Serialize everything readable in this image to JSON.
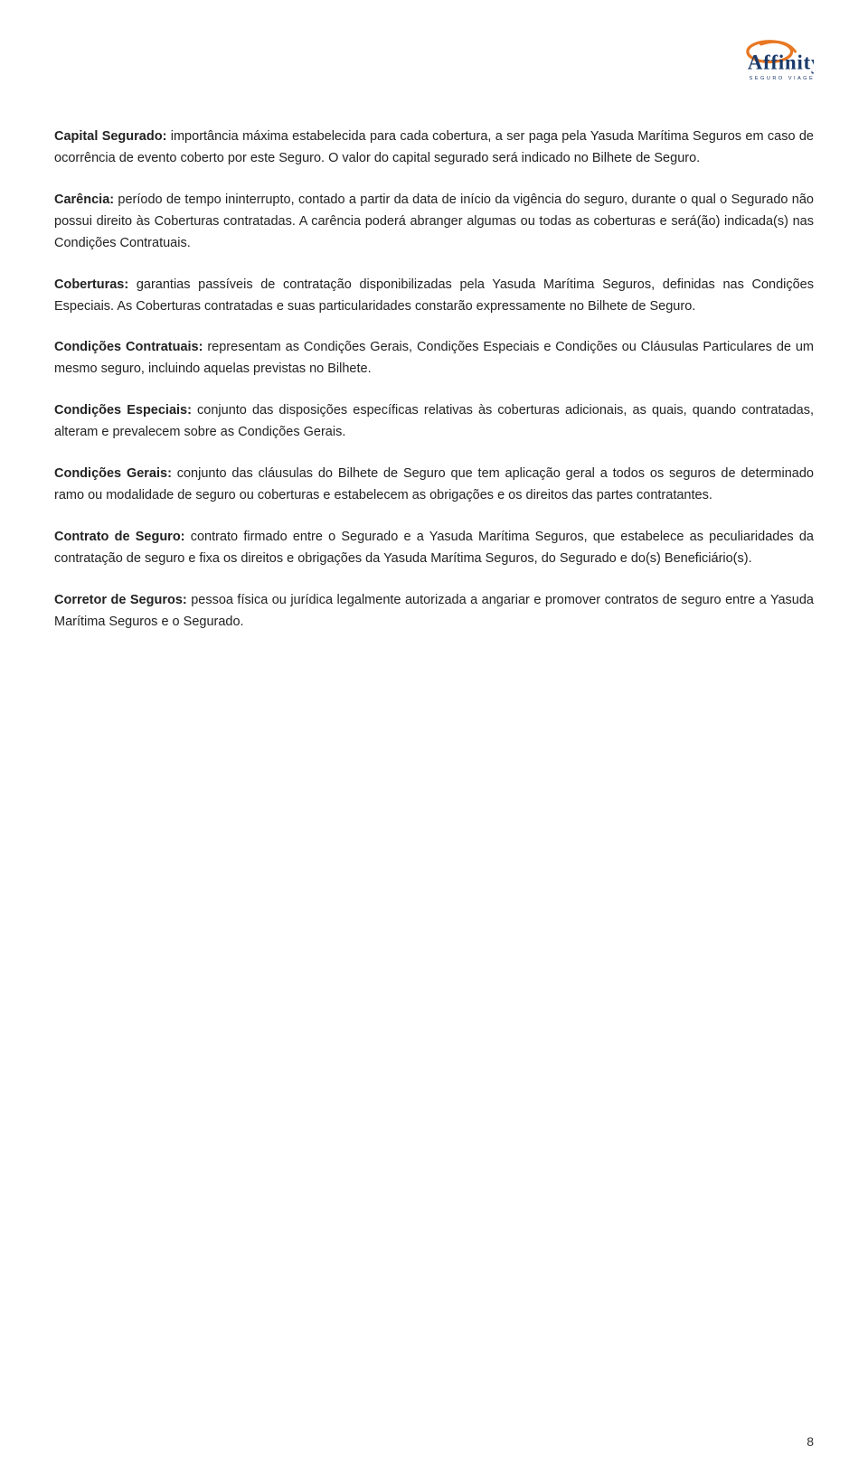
{
  "logo": {
    "alt": "Affinity Seguro Viagem"
  },
  "paragraphs": [
    {
      "id": "capital-segurado",
      "term": "Capital Segurado:",
      "text": " importância máxima estabelecida para cada cobertura, a ser paga pela Yasuda Marítima Seguros em caso de ocorrência de evento coberto por este Seguro. O valor do capital segurado será indicado no Bilhete de Seguro."
    },
    {
      "id": "carencia",
      "term": "Carência:",
      "text": " período de tempo ininterrupto, contado a partir da data de início da vigência do seguro, durante o qual o Segurado não possui direito às Coberturas contratadas. A carência poderá abranger algumas ou todas as coberturas e será(ão) indicada(s) nas Condições Contratuais."
    },
    {
      "id": "coberturas",
      "term": "Coberturas:",
      "text": " garantias passíveis de contratação disponibilizadas pela Yasuda Marítima Seguros, definidas nas Condições Especiais. As Coberturas contratadas e suas particularidades constarão expressamente no Bilhete de Seguro."
    },
    {
      "id": "condicoes-contratuais",
      "term": "Condições Contratuais:",
      "text": " representam as Condições Gerais, Condições Especiais e Condições ou Cláusulas Particulares de um mesmo seguro, incluindo aquelas previstas no Bilhete."
    },
    {
      "id": "condicoes-especiais",
      "term": "Condições Especiais:",
      "text": " conjunto das disposições específicas relativas às coberturas adicionais, as quais, quando contratadas, alteram e prevalecem sobre as Condições Gerais."
    },
    {
      "id": "condicoes-gerais",
      "term": "Condições Gerais:",
      "text": " conjunto das cláusulas do Bilhete de Seguro que tem aplicação geral a todos os seguros de determinado ramo ou modalidade de seguro ou coberturas e estabelecem as obrigações e os direitos das partes contratantes."
    },
    {
      "id": "contrato-de-seguro",
      "term": "Contrato de Seguro:",
      "text": " contrato firmado entre o Segurado e a Yasuda Marítima Seguros, que estabelece as peculiaridades da contratação de seguro e fixa os direitos e obrigações da Yasuda Marítima Seguros, do Segurado e do(s) Beneficiário(s)."
    },
    {
      "id": "corretor-de-seguros",
      "term": "Corretor de Seguros:",
      "text": " pessoa física ou jurídica legalmente autorizada a angariar e promover contratos de seguro entre a Yasuda Marítima Seguros e o Segurado."
    }
  ],
  "page_number": "8"
}
